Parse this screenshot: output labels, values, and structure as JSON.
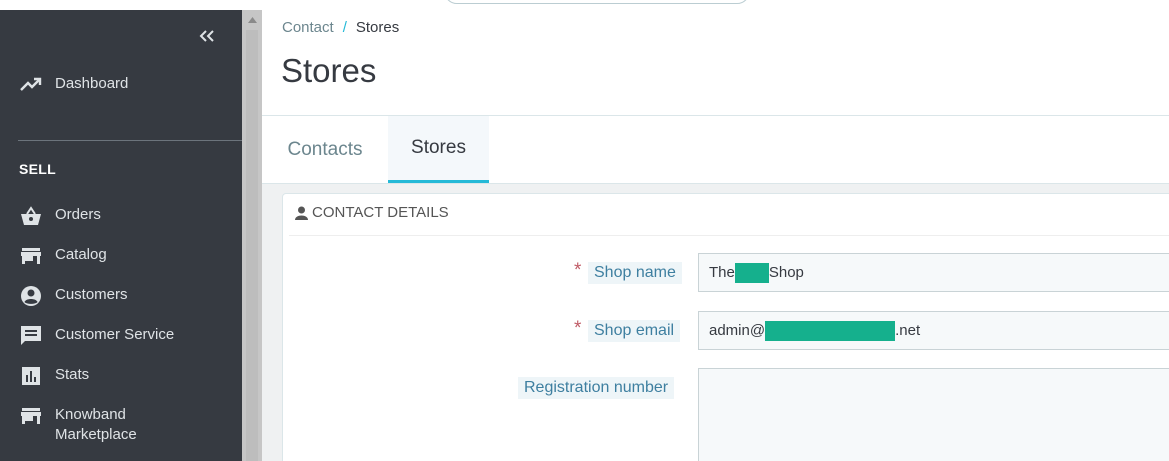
{
  "sidebar": {
    "items": [
      {
        "label": "Dashboard",
        "icon": "trending-up-icon"
      },
      {
        "label": "Orders",
        "icon": "basket-icon"
      },
      {
        "label": "Catalog",
        "icon": "store-icon"
      },
      {
        "label": "Customers",
        "icon": "account-circle-icon"
      },
      {
        "label": "Customer Service",
        "icon": "chat-icon"
      },
      {
        "label": "Stats",
        "icon": "bar-chart-icon"
      },
      {
        "label": "Knowband Marketplace",
        "icon": "store-icon"
      }
    ],
    "section_sell": "SELL"
  },
  "breadcrumb": {
    "parent": "Contact",
    "separator": "/",
    "current": "Stores"
  },
  "page_title": "Stores",
  "tabs": [
    {
      "label": "Contacts",
      "active": false
    },
    {
      "label": "Stores",
      "active": true
    }
  ],
  "panel": {
    "heading": "CONTACT DETAILS",
    "fields": {
      "shop_name": {
        "label": "Shop name",
        "required_mark": "*",
        "value_prefix": "The",
        "value_suffix": "Shop"
      },
      "shop_email": {
        "label": "Shop email",
        "required_mark": "*",
        "value_prefix": "admin@",
        "value_suffix": ".net"
      },
      "registration_number": {
        "label": "Registration number"
      }
    }
  },
  "colors": {
    "sidebar_bg": "#363a41",
    "accent": "#25b9d7",
    "redaction": "#15b08d",
    "label_text": "#3e7fa0",
    "required": "#c05c67"
  }
}
